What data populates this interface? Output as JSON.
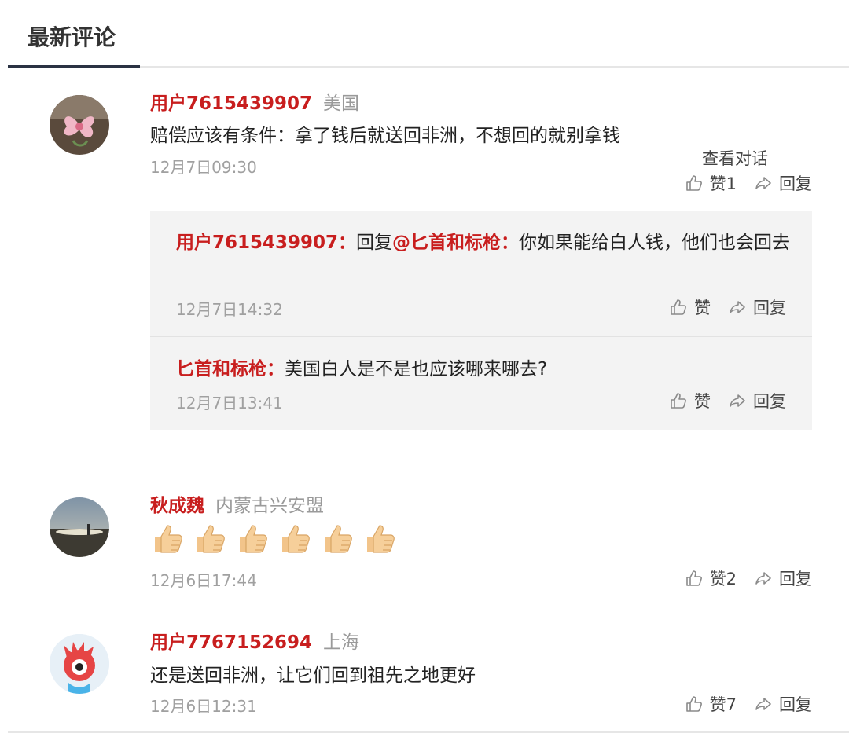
{
  "header": {
    "title": "最新评论"
  },
  "labels": {
    "like": "赞",
    "reply": "回复",
    "view_conversation": "查看对话",
    "reply_to_prefix": "回复"
  },
  "comments": [
    {
      "username": "用户7615439907",
      "location": "美国",
      "text": "赔偿应该有条件：拿了钱后就送回非洲，不想回的就别拿钱",
      "time": "12月7日09:30",
      "like_label": "赞1",
      "replies": [
        {
          "username": "用户7615439907：",
          "reply_to": "@匕首和标枪：",
          "text": "你如果能给白人钱，他们也会回去",
          "time": "12月7日14:32",
          "like_label": "赞"
        },
        {
          "username": "匕首和标枪：",
          "text": "美国白人是不是也应该哪来哪去?",
          "time": "12月7日13:41",
          "like_label": "赞"
        }
      ]
    },
    {
      "username": "秋成魏",
      "location": "内蒙古兴安盟",
      "text": "👍👍👍👍👍👍",
      "time": "12月6日17:44",
      "like_label": "赞2"
    },
    {
      "username": "用户7767152694",
      "location": "上海",
      "text": "还是送回非洲，让它们回到祖先之地更好",
      "time": "12月6日12:31",
      "like_label": "赞7"
    }
  ],
  "colors": {
    "username": "#c81e1e",
    "accent_underline": "#2a3243",
    "reply_bg": "#f3f3f3",
    "meta": "#a0a0a0"
  },
  "icons": {
    "like": "thumbs-up-icon",
    "reply": "reply-arrow-icon"
  }
}
